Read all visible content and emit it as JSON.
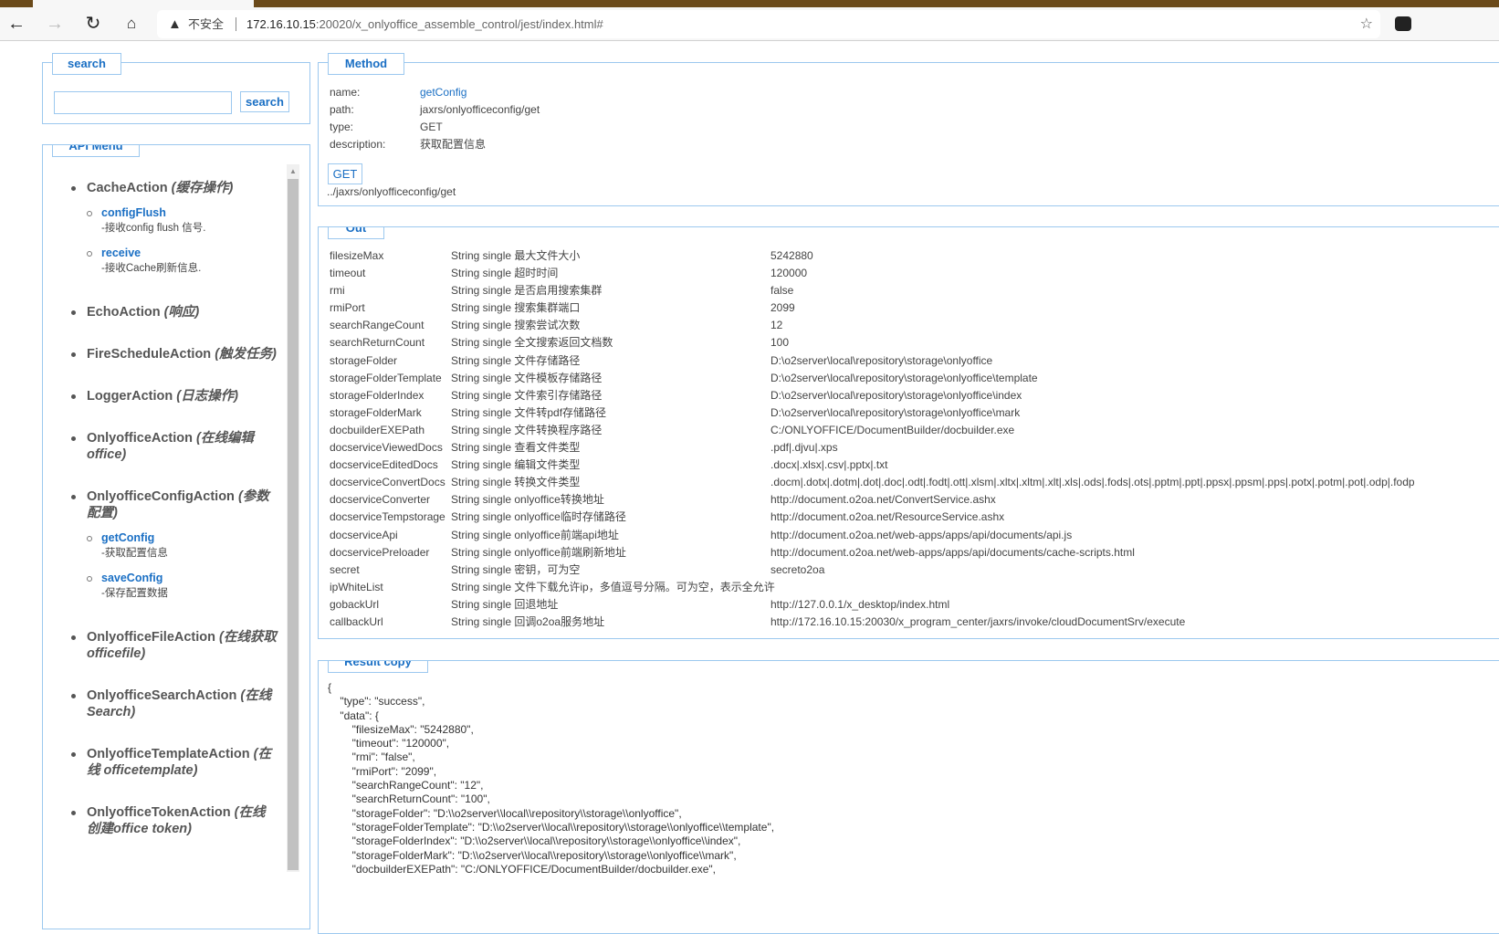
{
  "browser": {
    "security": "不安全",
    "url_host": "172.16.10.15",
    "url_rest": ":20020/x_onlyoffice_assemble_control/jest/index.html#"
  },
  "search": {
    "legend": "search",
    "button": "search",
    "value": ""
  },
  "menu": {
    "legend": "API Menu",
    "groups": [
      {
        "name": "CacheAction",
        "desc": "(缓存操作)",
        "items": [
          {
            "name": "configFlush",
            "desc": "-接收config flush 信号."
          },
          {
            "name": "receive",
            "desc": "-接收Cache刷新信息."
          }
        ]
      },
      {
        "name": "EchoAction",
        "desc": "(响应)",
        "items": []
      },
      {
        "name": "FireScheduleAction",
        "desc": "(触发任务)",
        "items": []
      },
      {
        "name": "LoggerAction",
        "desc": "(日志操作)",
        "items": []
      },
      {
        "name": "OnlyofficeAction",
        "desc": "(在线编辑 office)",
        "items": []
      },
      {
        "name": "OnlyofficeConfigAction",
        "desc": "(参数配置)",
        "items": [
          {
            "name": "getConfig",
            "desc": "-获取配置信息"
          },
          {
            "name": "saveConfig",
            "desc": "-保存配置数据"
          }
        ]
      },
      {
        "name": "OnlyofficeFileAction",
        "desc": "(在线获取 officefile)",
        "items": []
      },
      {
        "name": "OnlyofficeSearchAction",
        "desc": "(在线 Search)",
        "items": []
      },
      {
        "name": "OnlyofficeTemplateAction",
        "desc": "(在线 officetemplate)",
        "items": []
      },
      {
        "name": "OnlyofficeTokenAction",
        "desc": "(在线 创建office token)",
        "items": []
      }
    ]
  },
  "method": {
    "legend": "Method",
    "name_label": "name:",
    "name": "getConfig",
    "path_label": "path:",
    "path": "jaxrs/onlyofficeconfig/get",
    "type_label": "type:",
    "type": "GET",
    "desc_label": "description:",
    "desc": "获取配置信息",
    "button": "GET",
    "url": "../jaxrs/onlyofficeconfig/get"
  },
  "out": {
    "legend": "Out",
    "rows": [
      [
        "filesizeMax",
        "String single 最大文件大小",
        "5242880"
      ],
      [
        "timeout",
        "String single 超时时间",
        "120000"
      ],
      [
        "rmi",
        "String single 是否启用搜索集群",
        "false"
      ],
      [
        "rmiPort",
        "String single 搜索集群端口",
        "2099"
      ],
      [
        "searchRangeCount",
        "String single 搜索尝试次数",
        "12"
      ],
      [
        "searchReturnCount",
        "String single 全文搜索返回文档数",
        "100"
      ],
      [
        "storageFolder",
        "String single 文件存储路径",
        "D:\\o2server\\local\\repository\\storage\\onlyoffice"
      ],
      [
        "storageFolderTemplate",
        "String single 文件模板存储路径",
        "D:\\o2server\\local\\repository\\storage\\onlyoffice\\template"
      ],
      [
        "storageFolderIndex",
        "String single 文件索引存储路径",
        "D:\\o2server\\local\\repository\\storage\\onlyoffice\\index"
      ],
      [
        "storageFolderMark",
        "String single 文件转pdf存储路径",
        "D:\\o2server\\local\\repository\\storage\\onlyoffice\\mark"
      ],
      [
        "docbuilderEXEPath",
        "String single 文件转换程序路径",
        "C:/ONLYOFFICE/DocumentBuilder/docbuilder.exe"
      ],
      [
        "docserviceViewedDocs",
        "String single 查看文件类型",
        ".pdf|.djvu|.xps"
      ],
      [
        "docserviceEditedDocs",
        "String single 编辑文件类型",
        ".docx|.xlsx|.csv|.pptx|.txt"
      ],
      [
        "docserviceConvertDocs",
        "String single 转换文件类型",
        ".docm|.dotx|.dotm|.dot|.doc|.odt|.fodt|.ott|.xlsm|.xltx|.xltm|.xlt|.xls|.ods|.fods|.ots|.pptm|.ppt|.ppsx|.ppsm|.pps|.potx|.potm|.pot|.odp|.fodp"
      ],
      [
        "docserviceConverter",
        "String single onlyoffice转换地址",
        "http://document.o2oa.net/ConvertService.ashx"
      ],
      [
        "docserviceTempstorage",
        "String single onlyoffice临时存储路径",
        "http://document.o2oa.net/ResourceService.ashx"
      ],
      [
        "docserviceApi",
        "String single onlyoffice前端api地址",
        "http://document.o2oa.net/web-apps/apps/api/documents/api.js"
      ],
      [
        "docservicePreloader",
        "String single onlyoffice前端刷新地址",
        "http://document.o2oa.net/web-apps/apps/api/documents/cache-scripts.html"
      ],
      [
        "secret",
        "String single 密钥，可为空",
        "secreto2oa"
      ],
      [
        "ipWhiteList",
        "String single 文件下载允许ip，多值逗号分隔。可为空，表示全允许",
        ""
      ],
      [
        "gobackUrl",
        "String single 回退地址",
        "http://127.0.0.1/x_desktop/index.html"
      ],
      [
        "callbackUrl",
        "String single 回调o2oa服务地址",
        "http://172.16.10.15:20030/x_program_center/jaxrs/invoke/cloudDocumentSrv/execute"
      ]
    ]
  },
  "result": {
    "legend": "Result copy",
    "lines": [
      "{",
      "    \"type\": \"success\",",
      "    \"data\": {",
      "        \"filesizeMax\": \"5242880\",",
      "        \"timeout\": \"120000\",",
      "        \"rmi\": \"false\",",
      "        \"rmiPort\": \"2099\",",
      "        \"searchRangeCount\": \"12\",",
      "        \"searchReturnCount\": \"100\",",
      "        \"storageFolder\": \"D:\\\\o2server\\\\local\\\\repository\\\\storage\\\\onlyoffice\",",
      "        \"storageFolderTemplate\": \"D:\\\\o2server\\\\local\\\\repository\\\\storage\\\\onlyoffice\\\\template\",",
      "        \"storageFolderIndex\": \"D:\\\\o2server\\\\local\\\\repository\\\\storage\\\\onlyoffice\\\\index\",",
      "        \"storageFolderMark\": \"D:\\\\o2server\\\\local\\\\repository\\\\storage\\\\onlyoffice\\\\mark\",",
      "        \"docbuilderEXEPath\": \"C:/ONLYOFFICE/DocumentBuilder/docbuilder.exe\","
    ]
  }
}
